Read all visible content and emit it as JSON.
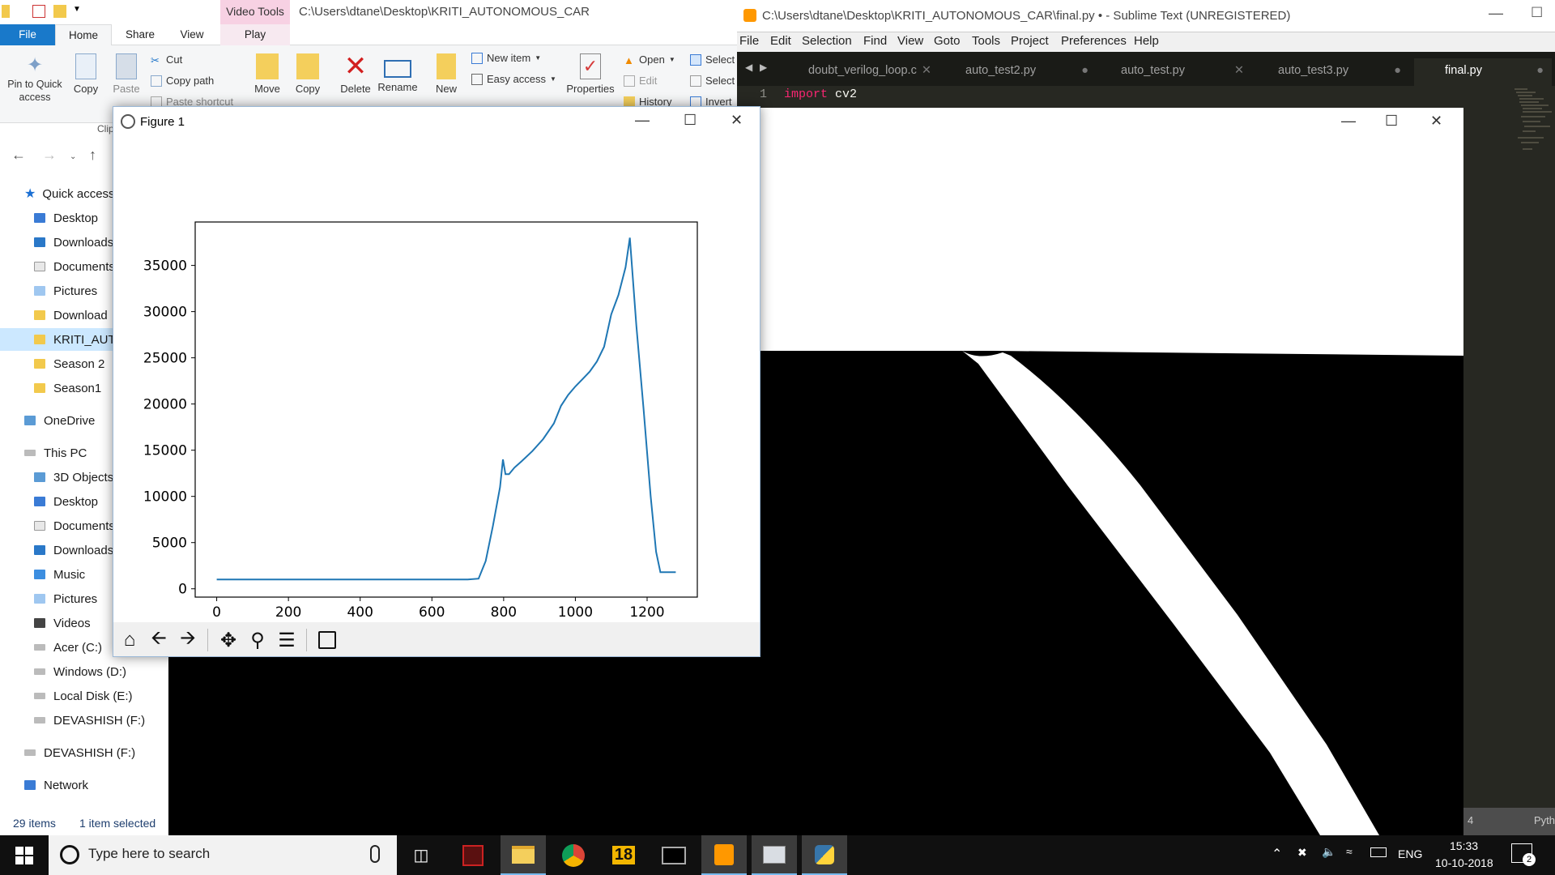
{
  "explorer": {
    "path": "C:\\Users\\dtane\\Desktop\\KRITI_AUTONOMOUS_CAR",
    "context_tab": "Video Tools",
    "tabs": [
      "File",
      "Home",
      "Share",
      "View",
      "Play"
    ],
    "ribbon": {
      "pin": "Pin to Quick access",
      "copy": "Copy",
      "paste": "Paste",
      "cut": "Cut",
      "copy_path": "Copy path",
      "paste_shortcut": "Paste shortcut",
      "clipboard_group": "Clip",
      "move": "Move",
      "copy_to": "Copy",
      "delete": "Delete",
      "rename": "Rename",
      "new": "New",
      "new_item": "New item",
      "easy_access": "Easy access",
      "properties": "Properties",
      "open": "Open",
      "edit": "Edit",
      "history": "History",
      "select1": "Select",
      "select2": "Select",
      "invert": "Invert"
    },
    "sidebar": [
      {
        "label": "Quick access",
        "icon": "star-icon"
      },
      {
        "label": "Desktop",
        "icon": "desktop-folder-icon"
      },
      {
        "label": "Downloads",
        "icon": "downloads-folder-icon"
      },
      {
        "label": "Documents",
        "icon": "documents-folder-icon"
      },
      {
        "label": "Pictures",
        "icon": "pictures-folder-icon"
      },
      {
        "label": "Download",
        "icon": "folder-icon"
      },
      {
        "label": "KRITI_AUTC",
        "icon": "folder-icon"
      },
      {
        "label": "Season 2",
        "icon": "folder-icon"
      },
      {
        "label": "Season1",
        "icon": "folder-icon"
      },
      {
        "label": "OneDrive",
        "icon": "onedrive-icon"
      },
      {
        "label": "This PC",
        "icon": "pc-icon"
      },
      {
        "label": "3D Objects",
        "icon": "3d-objects-icon"
      },
      {
        "label": "Desktop",
        "icon": "desktop-folder-icon"
      },
      {
        "label": "Documents",
        "icon": "documents-folder-icon"
      },
      {
        "label": "Downloads",
        "icon": "downloads-folder-icon"
      },
      {
        "label": "Music",
        "icon": "music-folder-icon"
      },
      {
        "label": "Pictures",
        "icon": "pictures-folder-icon"
      },
      {
        "label": "Videos",
        "icon": "videos-folder-icon"
      },
      {
        "label": "Acer (C:)",
        "icon": "drive-icon"
      },
      {
        "label": "Windows (D:)",
        "icon": "drive-icon"
      },
      {
        "label": "Local Disk (E:)",
        "icon": "drive-icon"
      },
      {
        "label": "DEVASHISH (F:)",
        "icon": "drive-icon"
      },
      {
        "label": "DEVASHISH (F:)",
        "icon": "usb-drive-icon"
      },
      {
        "label": "Network",
        "icon": "network-icon"
      }
    ],
    "status": {
      "items": "29 items",
      "selected": "1 item selected"
    }
  },
  "sublime": {
    "title": "C:\\Users\\dtane\\Desktop\\KRITI_AUTONOMOUS_CAR\\final.py • - Sublime Text (UNREGISTERED)",
    "menu": [
      "File",
      "Edit",
      "Selection",
      "Find",
      "View",
      "Goto",
      "Tools",
      "Project",
      "Preferences",
      "Help"
    ],
    "tabs": [
      "doubt_verilog_loop.c",
      "auto_test2.py",
      "auto_test.py",
      "auto_test3.py",
      "final.py"
    ],
    "code": {
      "line_number": "1",
      "keyword": "import",
      "module": "cv2"
    },
    "status_left": "4",
    "status_right": "Pyth"
  },
  "figure": {
    "title": "Figure 1",
    "toolbar": [
      "home-icon",
      "back-arrow-icon",
      "forward-arrow-icon",
      "pan-icon",
      "zoom-icon",
      "configure-subplots-icon",
      "save-icon"
    ]
  },
  "chart_data": {
    "type": "line",
    "title": "",
    "xlabel": "",
    "ylabel": "",
    "xlim": [
      -60,
      1340
    ],
    "ylim": [
      -900,
      39700
    ],
    "xticks": [
      "0",
      "200",
      "400",
      "600",
      "800",
      "1000",
      "1200"
    ],
    "yticks": [
      "0",
      "5000",
      "10000",
      "15000",
      "20000",
      "25000",
      "30000",
      "35000"
    ],
    "series": [
      {
        "color": "#1f77b4",
        "x": [
          0,
          100,
          200,
          300,
          400,
          500,
          600,
          700,
          730,
          750,
          770,
          790,
          798,
          805,
          815,
          830,
          850,
          880,
          910,
          940,
          960,
          980,
          1000,
          1020,
          1040,
          1060,
          1080,
          1100,
          1120,
          1140,
          1152,
          1170,
          1190,
          1210,
          1225,
          1237,
          1280
        ],
        "y": [
          1000,
          1000,
          1000,
          1000,
          1000,
          1000,
          1000,
          1000,
          1100,
          3000,
          6800,
          11000,
          14000,
          12400,
          12400,
          13100,
          13800,
          14900,
          16200,
          17900,
          19800,
          21000,
          21900,
          22700,
          23500,
          24600,
          26200,
          29700,
          31800,
          34800,
          38000,
          28500,
          19500,
          10000,
          4000,
          1800,
          1800
        ]
      }
    ]
  },
  "taskbar": {
    "search_placeholder": "Type here to search",
    "apps": [
      "task-view-icon",
      "predator-icon",
      "file-explorer-icon",
      "chrome-icon",
      "badge-18-icon",
      "terminal-icon",
      "sublime-text-icon",
      "python-figure-icon",
      "python-icon"
    ],
    "language": "ENG",
    "time": "15:33",
    "date": "10-10-2018",
    "notifications": "2"
  }
}
